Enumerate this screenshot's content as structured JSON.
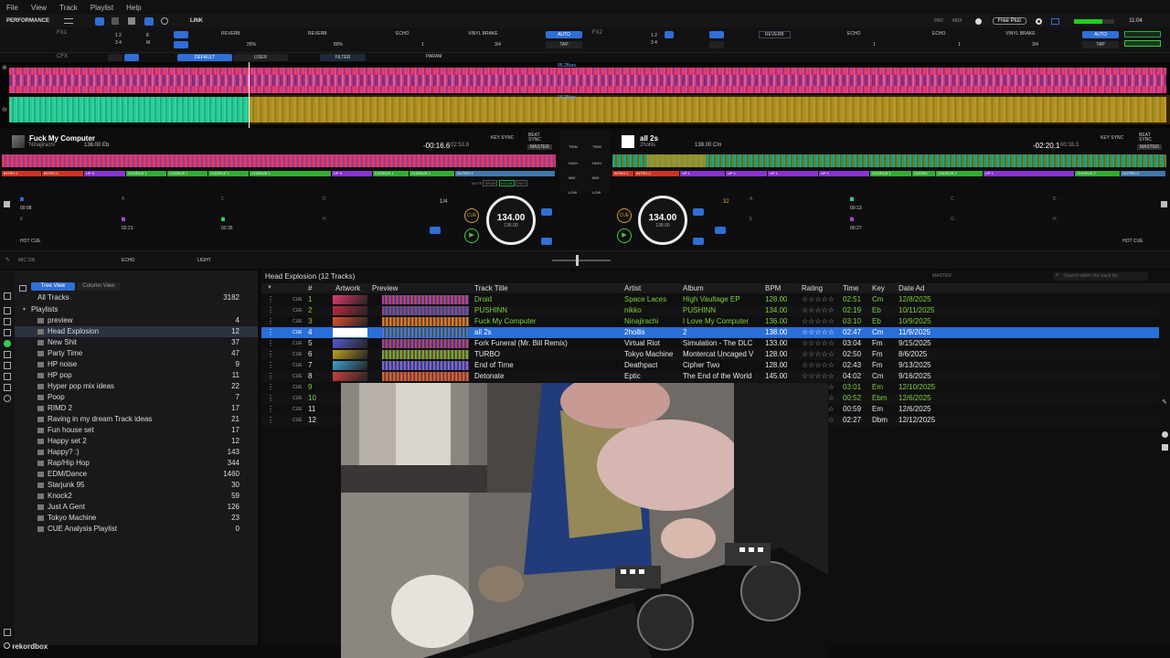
{
  "menu": [
    "File",
    "View",
    "Track",
    "Playlist",
    "Help"
  ],
  "topbar": {
    "mode": "PERFORMANCE",
    "link": "LINK",
    "right_labels": [
      "PAD",
      "MIDI"
    ],
    "plan": "Free Plus",
    "clock": "11:04"
  },
  "fx1": {
    "label": "FX1",
    "effects": [
      "REVERB",
      "REVERB",
      "ECHO",
      "VINYL BRAKE"
    ],
    "values": [
      "25%",
      "80%",
      "1",
      "3/4"
    ],
    "auto": "AUTO",
    "tap": "TAP"
  },
  "fx2": {
    "label": "FX2",
    "effects": [
      "REVERB",
      "ECHO",
      "ECHO",
      "VINYL BRAKE"
    ],
    "values": [
      "",
      "1",
      "1",
      "3/4"
    ],
    "auto": "AUTO",
    "tap": "TAP"
  },
  "cfx": {
    "label": "CFX",
    "tabs": [
      "DEFAULT",
      "USER"
    ],
    "filter": "FILTER",
    "param": "PARAM"
  },
  "bigwave": {
    "upper_bars": "95.2Bars",
    "lower_bars": "16.2Bars"
  },
  "deck1": {
    "title": "Fuck My Computer",
    "artist": "Ninajirachi",
    "bpm_key": "136.00 Eb",
    "remaining": "-00:16.6",
    "elapsed": "02:53.8",
    "key_sync": "KEY SYNC",
    "beat_sync": "BEAT SYNC",
    "master": "MASTER",
    "phrases": [
      "INTRO 1",
      "INTRO 2",
      "UP 3",
      "CHORUS 1",
      "CHORUS 1",
      "CHORUS 1",
      "CHORUS 1",
      "UP 3",
      "CHORUS 1",
      "CHORUS 2",
      "OUTRO 1"
    ],
    "tags": [
      "MUTE",
      "DRUM",
      "VOCAL",
      "INST"
    ],
    "jog_bpm": "134.00",
    "jog_sub": "136.00",
    "beat_fraction": "1/4",
    "hotcue_times": [
      "00:08",
      "02:21",
      "02:35"
    ],
    "hotcue_letters": [
      "A",
      "B",
      "C",
      "D",
      "E",
      "F",
      "G",
      "H"
    ],
    "hotcue_label": "HOT CUE"
  },
  "deck2": {
    "title": "all 2s",
    "artist": "2hollis",
    "bpm_key": "138.00 Cm",
    "remaining": "-02:20.1",
    "elapsed": "00:18.3",
    "key_sync": "KEY SYNC",
    "beat_sync": "BEAT SYNC",
    "master": "MASTER",
    "phrases": [
      "INTRO 1",
      "INTRO 2",
      "UP 1",
      "UP 1",
      "UP 1",
      "UP 1",
      "CHORUS 1",
      "CHORU",
      "CHORUS 2",
      "UP 1",
      "CHORUS 2",
      "OUTRO 2"
    ],
    "jog_bpm": "134.00",
    "jog_sub": "138.00",
    "beat_number": "32",
    "hotcue_times": [
      "00:13",
      "00:27"
    ],
    "hotcue_letters": [
      "A",
      "B",
      "C",
      "D",
      "E",
      "F",
      "G",
      "H"
    ],
    "hotcue_label": "HOT CUE"
  },
  "mixer": {
    "trim": "TRIM",
    "high": "HIGH",
    "mid": "MID",
    "low": "LOW",
    "cue": "CUE",
    "stem": "STEM"
  },
  "fxbar2": {
    "mic": "MIC ON",
    "echo": "ECHO",
    "light": "LIGHT"
  },
  "tree": {
    "tabs": [
      "Tree View",
      "Column View"
    ],
    "all_tracks": {
      "label": "All Tracks",
      "count": "3182"
    },
    "playlists_label": "Playlists",
    "items": [
      {
        "name": "preview",
        "count": "4"
      },
      {
        "name": "Head Explosion",
        "count": "12"
      },
      {
        "name": "New Shit",
        "count": "37"
      },
      {
        "name": "Party Time",
        "count": "47"
      },
      {
        "name": "HP noise",
        "count": "9"
      },
      {
        "name": "HP pop",
        "count": "11"
      },
      {
        "name": "Hyper pop mix ideas",
        "count": "22"
      },
      {
        "name": "Poop",
        "count": "7"
      },
      {
        "name": "RIMD 2",
        "count": "17"
      },
      {
        "name": "Raving in my dream Track ideas",
        "count": "21"
      },
      {
        "name": "Fun house set",
        "count": "17"
      },
      {
        "name": "Happy set 2",
        "count": "12"
      },
      {
        "name": "Happy? :)",
        "count": "143"
      },
      {
        "name": "Rap/Hip Hop",
        "count": "344"
      },
      {
        "name": "EDM/Dance",
        "count": "1460"
      },
      {
        "name": "Starjunk 95",
        "count": "30"
      },
      {
        "name": "Knock2",
        "count": "59"
      },
      {
        "name": "Just A Gent",
        "count": "126"
      },
      {
        "name": "Tokyo Machine",
        "count": "23"
      },
      {
        "name": "CUE Analysis Playlist",
        "count": "0"
      }
    ]
  },
  "tracklist": {
    "heading": "Head Explosion (12 Tracks)",
    "search_placeholder": "Search within this track list",
    "master": "MASTER",
    "columns": [
      "#",
      "Artwork",
      "Preview",
      "Track Title",
      "Artist",
      "Album",
      "BPM",
      "Rating",
      "Time",
      "Key",
      "Date Ad"
    ],
    "rows": [
      {
        "n": "1",
        "title": "Droid",
        "artist": "Space Laces",
        "album": "High Vaultage EP",
        "bpm": "128.00",
        "time": "02:51",
        "key": "Cm",
        "date": "12/8/2025",
        "green": true
      },
      {
        "n": "2",
        "title": "PUSHINN",
        "artist": "nikko",
        "album": "PUSHINN",
        "bpm": "134.00",
        "time": "02:19",
        "key": "Eb",
        "date": "10/11/2025",
        "green": true
      },
      {
        "n": "3",
        "title": "Fuck My Computer",
        "artist": "Ninajirachi",
        "album": "I Love My Computer",
        "bpm": "136.00",
        "time": "03:10",
        "key": "Eb",
        "date": "10/9/2025",
        "green": true
      },
      {
        "n": "4",
        "title": "all 2s",
        "artist": "2hollis",
        "album": "2",
        "bpm": "138.00",
        "time": "02:47",
        "key": "Cm",
        "date": "11/9/2025",
        "green": true
      },
      {
        "n": "5",
        "title": "Fork Funeral (Mr. Bill Remix)",
        "artist": "Virtual Riot",
        "album": "Simulation - The DLC",
        "bpm": "133.00",
        "time": "03:04",
        "key": "Fm",
        "date": "9/15/2025",
        "green": false
      },
      {
        "n": "6",
        "title": "TURBO",
        "artist": "Tokyo Machine",
        "album": "Montercat Uncaged V",
        "bpm": "128.00",
        "time": "02:50",
        "key": "Fm",
        "date": "8/6/2025",
        "green": false
      },
      {
        "n": "7",
        "title": "End of Time",
        "artist": "Deathpact",
        "album": "Cipher Two",
        "bpm": "128.00",
        "time": "02:43",
        "key": "Fm",
        "date": "9/13/2025",
        "green": false
      },
      {
        "n": "8",
        "title": "Detonate",
        "artist": "Eptic",
        "album": "The End of the World",
        "bpm": "145.00",
        "time": "04:02",
        "key": "Cm",
        "date": "9/16/2025",
        "green": false
      },
      {
        "n": "9",
        "title": "",
        "artist": "",
        "album": "",
        "bpm": "",
        "time": "03:01",
        "key": "Em",
        "date": "12/10/2025",
        "green": true
      },
      {
        "n": "10",
        "title": "",
        "artist": "",
        "album": "",
        "bpm": "",
        "time": "00:52",
        "key": "Ebm",
        "date": "12/6/2025",
        "green": true
      },
      {
        "n": "11",
        "title": "",
        "artist": "",
        "album": "",
        "bpm": "",
        "time": "00:59",
        "key": "Em",
        "date": "12/6/2025",
        "green": false
      },
      {
        "n": "12",
        "title": "",
        "artist": "",
        "album": "",
        "bpm": "",
        "time": "02:27",
        "key": "Dbm",
        "date": "12/12/2025",
        "green": false
      }
    ],
    "rating": "☆☆☆☆☆",
    "cue": "CUE"
  },
  "footer": {
    "logo": "rekordbox"
  },
  "colors": {
    "accent": "#2f6fd6",
    "selected_row": "#2a6ed8",
    "green_text": "#7fd13b"
  }
}
